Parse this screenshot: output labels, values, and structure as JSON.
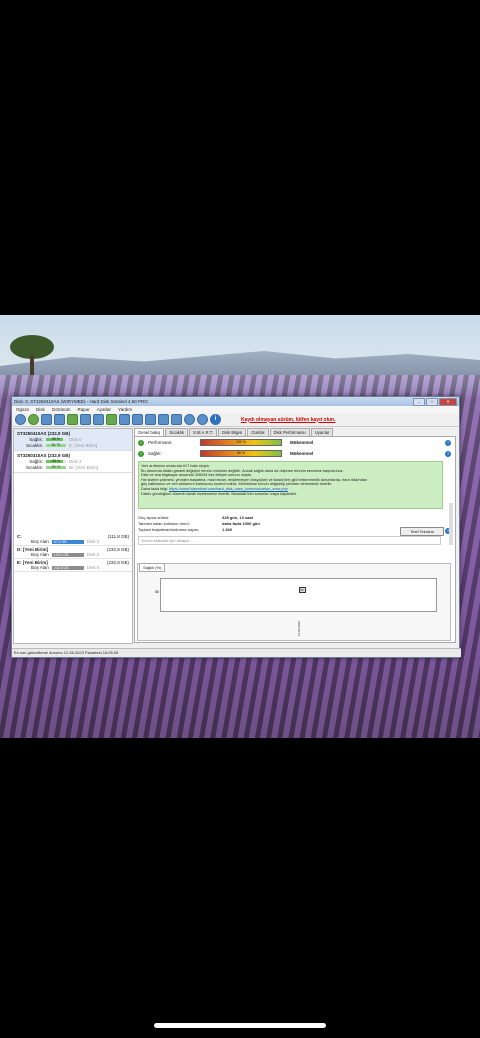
{
  "window": {
    "title": "Disk: 0, ST3250410AS (WIRYMBD) - Hard Disk Sentinel 4.50 PRO",
    "menu": [
      "Ogsze",
      "Disk",
      "Görünüm",
      "Rapor",
      "Ayarlar",
      "Yardım"
    ],
    "register_notice": "Kaydı olmayan sürüm, lütfen kayıt olun."
  },
  "disks": [
    {
      "name": "ST3250410AS",
      "size": "(232,9 GB)",
      "health_label": "Sağlık:",
      "health_value": "86 %",
      "health_pct": 86,
      "disk_ref": "Disk 0",
      "temp_label": "Sıcaklık:",
      "temp_value": "24 °C",
      "vol_ref": "E: [Yeni Birim]"
    },
    {
      "name": "ST3250310AS",
      "size": "(232,9 GB)",
      "health_label": "Sağlık:",
      "health_value": "85 %",
      "health_pct": 85,
      "disk_ref": "Disk 2",
      "temp_label": "Sıcaklık:",
      "temp_value": "23 °C",
      "vol_ref": "Bi: [Yeni Birim]"
    }
  ],
  "partitions": [
    {
      "drive": "C:",
      "size": "(111,8 GB)",
      "free_label": "Boş Alan",
      "free_value": "67,4 GB",
      "disk_ref": "Disk 2",
      "blue": true
    },
    {
      "drive": "D: [Yeni Birim]",
      "size": "(232,9 GB)",
      "free_label": "Boş Alan",
      "free_value": "120,0 GB",
      "disk_ref": "Disk 2",
      "blue": false
    },
    {
      "drive": "E: [Yeni Birim]",
      "size": "(232,9 GB)",
      "free_label": "Boş Alan",
      "free_value": "232,8 GB",
      "disk_ref": "Disk 0",
      "blue": false
    }
  ],
  "tabs": [
    "Genel bakış",
    "Sıcaklık",
    "S.M.A.R.T.",
    "Disk Bilgisi",
    "Günlük",
    "Disk Performansı",
    "Uyarılar"
  ],
  "health_rows": [
    {
      "label": "Performans:",
      "bar": "100 %",
      "result": "Mükemmel"
    },
    {
      "label": "Sağlık:",
      "bar": "86 %",
      "result": "Mükemmel"
    }
  ],
  "message": {
    "lines": [
      "Yeni arıtlamını sırasında #17 hata oluştu.",
      "Bu durumda diskin garanti değişimi henüz mümkün değildir. Ancak sağlık daha da düşerse ürünün servisine başvurunuz.",
      "Disk ve ana bilgisayar arasında 326044 kez iletişim sorunu oluştu.",
      "Hiz sistem çökmesi, yeniden başlatma, mavi ekran, erişilemeyen dosya(lar) ve klasör(ler) gibi beklenmedik durumlarda, hard disk/ndan",
      "güç kablosunu ve veri arıtlamını kablosunu kontrol ediniz. Mümkünse bunun değiştirip yeniden denemeniz önerilir.",
      "Daha fazla bilgi:"
    ],
    "link": "https://www.hdsentinel.com/hard_disk_case_communication_error.php",
    "tail": [
      "Diskin gündüğünü düzenli olarak incelemeniz önerilir. Buradaki tüm sorunlar oraya kaydedilir."
    ]
  },
  "stats": [
    {
      "label": "Güç açma süresi:",
      "value": "328 gün, 13 saat"
    },
    {
      "label": "Tahmini kalan kullanım ömrü:",
      "value": "daha fazla 1000 gün"
    },
    {
      "label": "Toplam başlatma/durdurma sayısı:",
      "value": "1.340"
    }
  ],
  "test_button": "Testi Tekrarla",
  "comment_placeholder": "Yorum eklemek için tıklayın ...",
  "chart_tab": "Sağlık (%)",
  "chart_data": {
    "type": "line",
    "x": [
      "12.06.2023"
    ],
    "series": [
      {
        "values": [
          86
        ]
      }
    ],
    "point_labels": [
      "86"
    ],
    "ytick": "86",
    "xtick": "12.06.2023"
  },
  "statusbar": "En son güncelleme durumu 12.06.2023 Pazartesi 16:05:05"
}
